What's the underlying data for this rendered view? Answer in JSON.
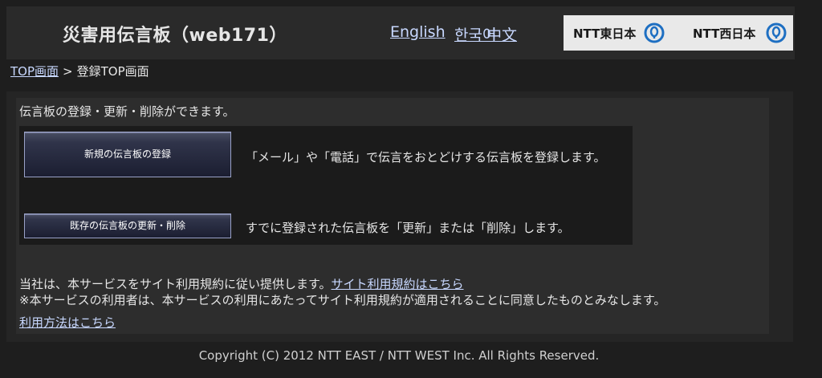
{
  "header": {
    "title": "災害用伝言板（web171）",
    "lang_english": "English",
    "lang_korean": "한국어",
    "lang_chinese": "中文",
    "logo_east": "NTT東日本",
    "logo_west": "NTT西日本"
  },
  "breadcrumb": {
    "home": "TOP画面",
    "separator": ">",
    "current": "登録TOP画面"
  },
  "main": {
    "intro": "伝言板の登録・更新・削除ができます。",
    "new_button": "新規の伝言板の登録",
    "new_desc": "「メール」や「電話」で伝言をおとどけする伝言板を登録します。",
    "edit_button": "既存の伝言板の更新・削除",
    "edit_desc": "すでに登録された伝言板を「更新」または「削除」します。",
    "terms_text": "当社は、本サービスをサイト利用規約に従い提供します。",
    "terms_link": "サイト利用規約はこちら",
    "terms_note": "※本サービスの利用者は、本サービスの利用にあたってサイト利用規約が適用されることに同意したものとみなします。",
    "usage_link": "利用方法はこちら"
  },
  "footer": {
    "copyright": "Copyright (C) 2012 NTT EAST / NTT WEST Inc. All Rights Reserved."
  },
  "colors": {
    "background": "#1e1e1e",
    "link": "#c8d8ff",
    "logo_blue": "#1e6fc2"
  }
}
